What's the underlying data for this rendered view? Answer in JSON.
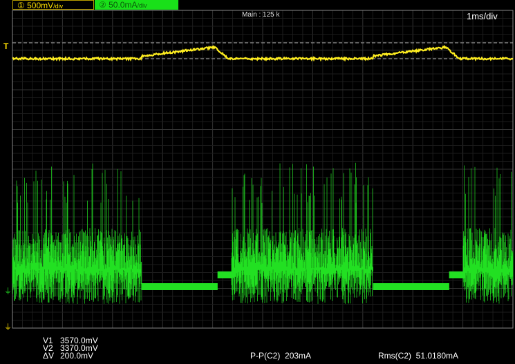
{
  "channels": [
    {
      "label": "500mV",
      "unit_suffix": "/div",
      "color": "#ffe000"
    },
    {
      "label": "50.0mA",
      "unit_suffix": "/div",
      "color": "#19e019"
    }
  ],
  "header": {
    "main": "Main : 125 k",
    "timebase": "1ms/div"
  },
  "markers": {
    "trigger": "T"
  },
  "cursors": {
    "v1_label": "V1",
    "v1": "3570.0mV",
    "v2_label": "V2",
    "v2": "3370.0mV",
    "dv_label": "ΔV",
    "dv": "200.0mV"
  },
  "measurements": {
    "pp_label": "P-P(C2)",
    "pp": "203mA",
    "rms_label": "Rms(C2)",
    "rms": "51.0180mA"
  }
}
